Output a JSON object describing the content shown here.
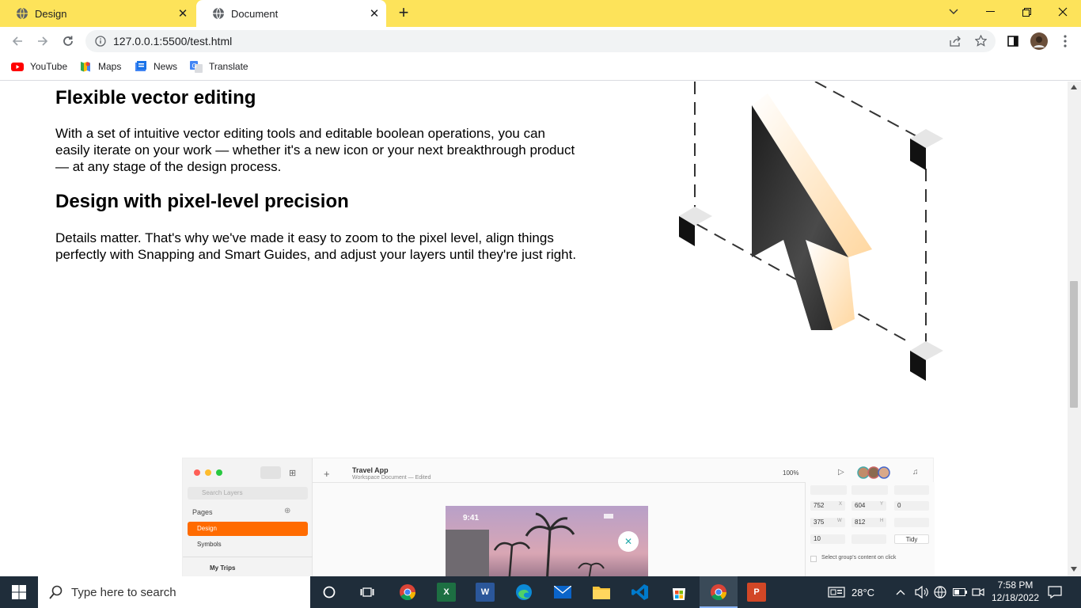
{
  "browser": {
    "tabs": [
      {
        "label": "Design"
      },
      {
        "label": "Document"
      }
    ],
    "url": "127.0.0.1:5500/test.html",
    "bookmarks": [
      {
        "label": "YouTube"
      },
      {
        "label": "Maps"
      },
      {
        "label": "News"
      },
      {
        "label": "Translate"
      }
    ]
  },
  "content": {
    "section1": {
      "heading": "Flexible vector editing",
      "line1": "With a set of intuitive vector editing tools and editable boolean operations, you can",
      "line2": "easily iterate on your work — whether it's a new icon or your next breakthrough product",
      "line3": "— at any stage of the design process."
    },
    "section2": {
      "heading": "Design with pixel-level precision",
      "line1": "Details matter. That's why we've made it easy to zoom to the pixel level, align things",
      "line2": "perfectly with Snapping and Smart Guides, and adjust your layers until they're just right."
    }
  },
  "app_mock": {
    "doc_title": "Travel App",
    "doc_subtitle": "Workspace Document — Edited",
    "search_placeholder": "Search Layers",
    "pages_label": "Pages",
    "pages": [
      {
        "label": "Design"
      },
      {
        "label": "Symbols"
      }
    ],
    "layer": "My Trips",
    "zoom": "100%",
    "phone_time": "9:41",
    "inspector": {
      "x": "752",
      "y": "604",
      "rot": "0",
      "w": "375",
      "h": "812",
      "r": "10",
      "tidy": "Tidy",
      "x_label": "X",
      "y_label": "Y",
      "w_label": "W",
      "h_label": "H",
      "select_group": "Select group's content on click"
    }
  },
  "taskbar": {
    "search_placeholder": "Type here to search",
    "weather": "28°C",
    "time": "7:58 PM",
    "date": "12/18/2022"
  },
  "colors": {
    "tabbar": "#fde35a",
    "accent_orange": "#ff6b00",
    "taskbar": "#1f2d3a"
  }
}
